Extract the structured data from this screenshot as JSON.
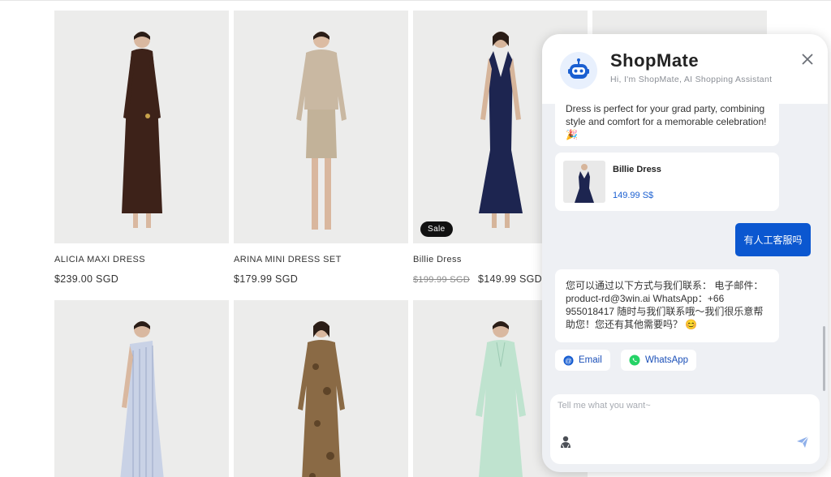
{
  "products": [
    {
      "name": "ALICIA MAXI DRESS",
      "price": "$239.00 SGD",
      "old_price": "",
      "sale": ""
    },
    {
      "name": "ARINA MINI DRESS SET",
      "price": "$179.99 SGD",
      "old_price": "",
      "sale": ""
    },
    {
      "name": "Billie Dress",
      "price": "$149.99 SGD",
      "old_price": "$199.99 SGD",
      "sale": "Sale"
    }
  ],
  "colors": {
    "accent": "#0b57d0",
    "dress_brown": "#3d2219",
    "dress_beige": "#c9b8a2",
    "dress_navy": "#1d2550",
    "dress_stripe": "#c9d2e6",
    "dress_snake": "#8a6a45",
    "dress_mint": "#bfe3cf"
  },
  "chat": {
    "title": "ShopMate",
    "subtitle": "Hi, I'm ShopMate, AI Shopping Assistant",
    "bot_message_1": "Dress is perfect for your grad party, combining style and comfort for a memorable celebration! 🎉",
    "product_card": {
      "name": "Billie Dress",
      "price": "149.99 S$"
    },
    "user_message": "有人工客服吗",
    "bot_message_2": "您可以通过以下方式与我们联系： 电子邮件：product-rd@3win.ai WhatsApp：+66 955018417 随时与我们联系哦～我们很乐意帮助您！您还有其他需要吗？ 😊",
    "email_label": "Email",
    "whatsapp_label": "WhatsApp",
    "input_placeholder": "Tell me what you want~",
    "icons": {
      "bot": "robot-icon",
      "close": "close-icon",
      "email": "email-icon",
      "whatsapp": "whatsapp-icon",
      "agent": "agent-icon",
      "send": "send-icon"
    }
  }
}
